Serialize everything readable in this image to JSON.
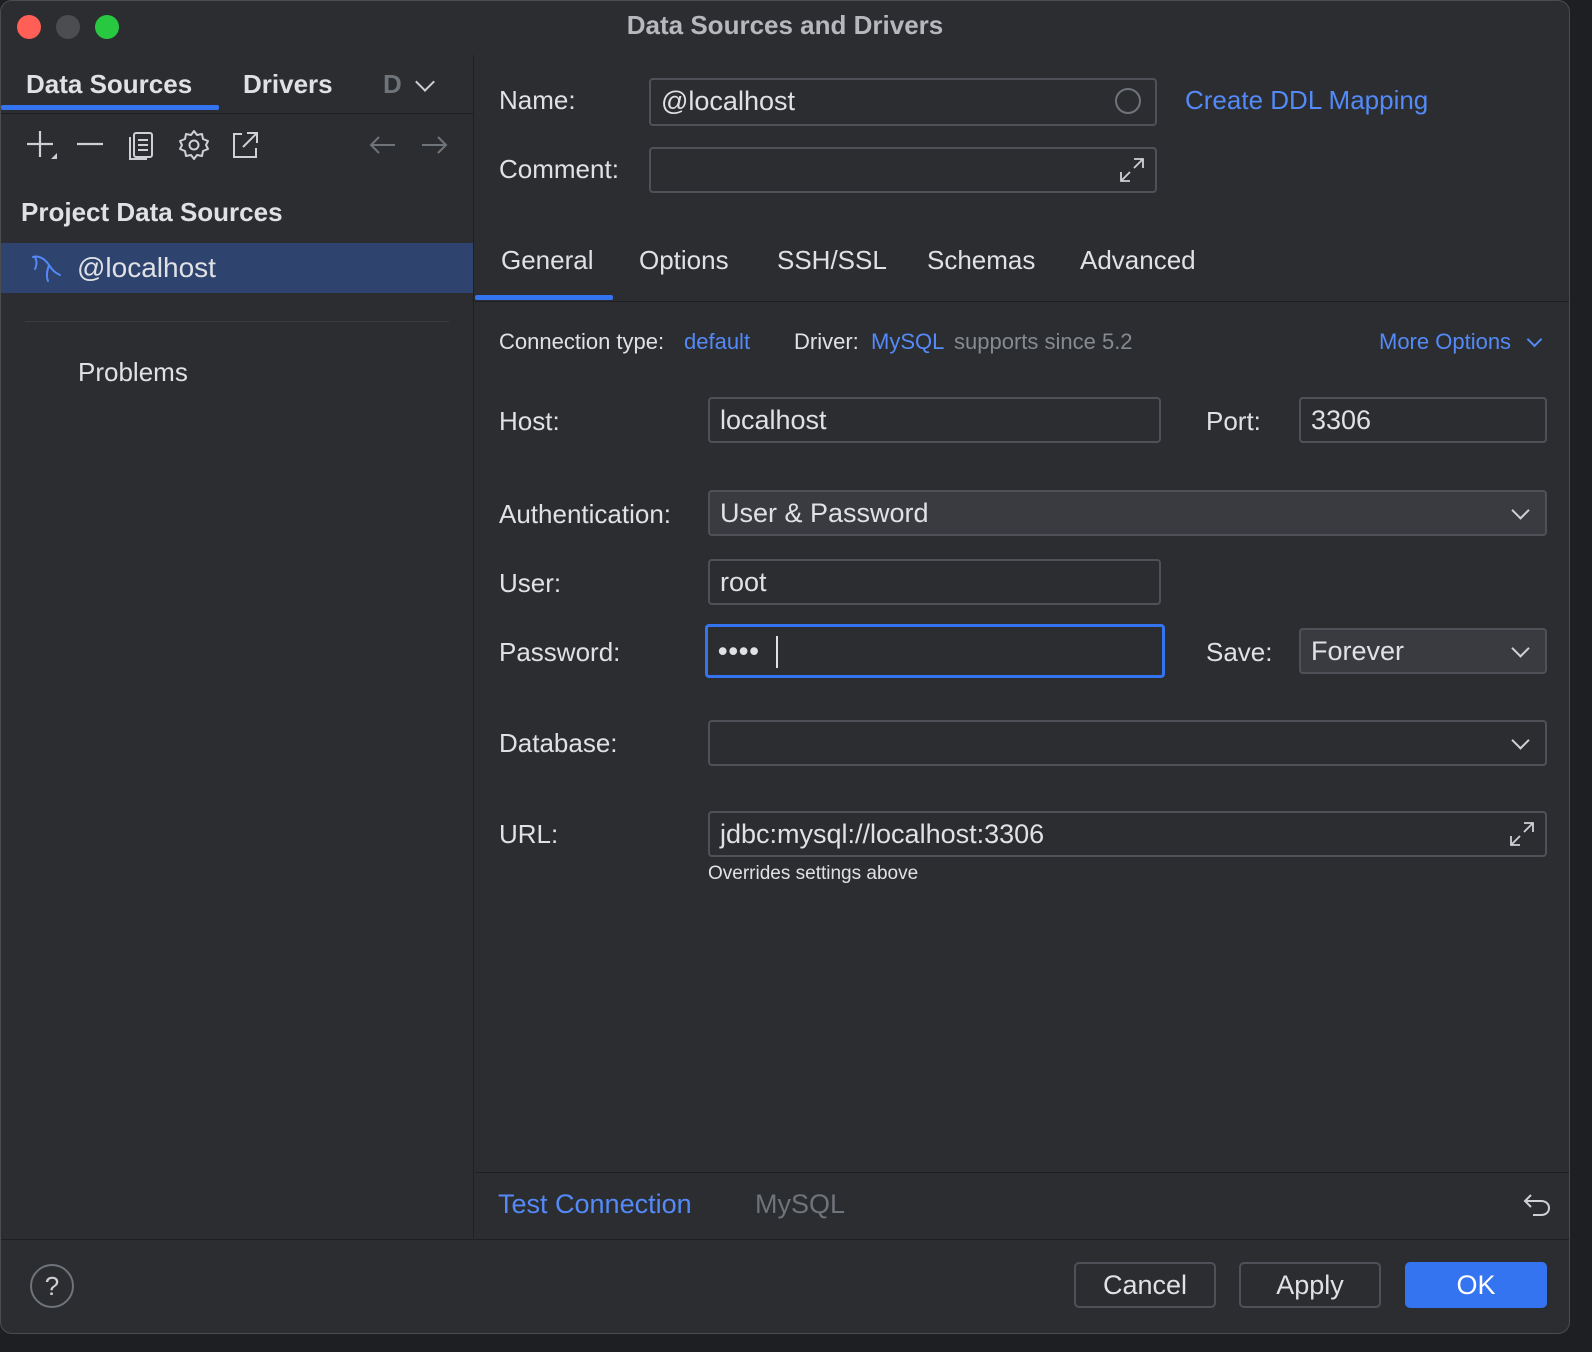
{
  "window": {
    "title": "Data Sources and Drivers"
  },
  "left": {
    "tabs": [
      {
        "label": "Data Sources"
      },
      {
        "label": "Drivers"
      }
    ],
    "tab_overflow": "D",
    "section_title": "Project Data Sources",
    "items": [
      {
        "label": "@localhost",
        "icon": "mysql-dolphin-icon"
      }
    ],
    "problems_label": "Problems"
  },
  "form": {
    "name_label": "Name:",
    "name_value": "@localhost",
    "create_ddl_label": "Create DDL Mapping",
    "comment_label": "Comment:",
    "comment_value": ""
  },
  "tabs": [
    {
      "label": "General"
    },
    {
      "label": "Options"
    },
    {
      "label": "SSH/SSL"
    },
    {
      "label": "Schemas"
    },
    {
      "label": "Advanced"
    }
  ],
  "general": {
    "connection_type_label": "Connection type:",
    "connection_type_value": "default",
    "driver_label": "Driver:",
    "driver_value": "MySQL",
    "driver_note": "supports since 5.2",
    "more_options_label": "More Options",
    "host_label": "Host:",
    "host_value": "localhost",
    "port_label": "Port:",
    "port_value": "3306",
    "auth_label": "Authentication:",
    "auth_value": "User & Password",
    "user_label": "User:",
    "user_value": "root",
    "password_label": "Password:",
    "password_value": "••••",
    "save_label": "Save:",
    "save_value": "Forever",
    "database_label": "Database:",
    "database_value": "",
    "url_label": "URL:",
    "url_value": "jdbc:mysql://localhost:3306",
    "url_hint": "Overrides settings above"
  },
  "bottom": {
    "test_connection_label": "Test Connection",
    "driver_name": "MySQL"
  },
  "footer": {
    "help_label": "?",
    "cancel_label": "Cancel",
    "apply_label": "Apply",
    "ok_label": "OK"
  },
  "colors": {
    "accent": "#3574f0",
    "link": "#548af7",
    "selection": "#2e436e",
    "background": "#2b2d30"
  }
}
